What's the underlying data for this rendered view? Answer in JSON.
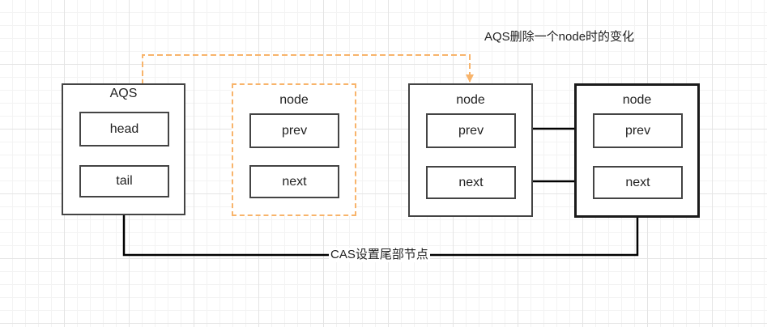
{
  "diagram": {
    "caption": "AQS删除一个node时的变化",
    "aqs": {
      "title": "AQS",
      "head_label": "head",
      "tail_label": "tail"
    },
    "removed_node": {
      "title": "node",
      "prev_label": "prev",
      "next_label": "next"
    },
    "middle_node": {
      "title": "node",
      "prev_label": "prev",
      "next_label": "next"
    },
    "tail_node": {
      "title": "node",
      "prev_label": "prev",
      "next_label": "next"
    },
    "cas_label": "CAS设置尾部节点",
    "colors": {
      "dashed_accent": "#f8b46b",
      "stroke": "#444444",
      "arrow": "#000000",
      "grid": "#e4e4e4"
    }
  }
}
